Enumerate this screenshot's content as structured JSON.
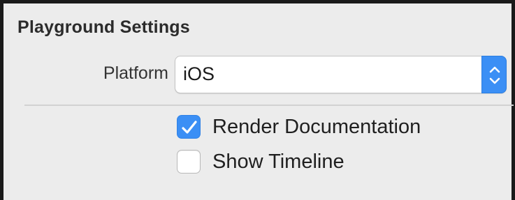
{
  "panel": {
    "title": "Playground Settings"
  },
  "platform": {
    "label": "Platform",
    "selected": "iOS",
    "stepper_icon": "up-down-chevrons-icon"
  },
  "options": [
    {
      "label": "Render Documentation",
      "checked": true
    },
    {
      "label": "Show Timeline",
      "checked": false
    }
  ],
  "colors": {
    "accent": "#3b8ff5",
    "panel_bg": "#ececec"
  }
}
